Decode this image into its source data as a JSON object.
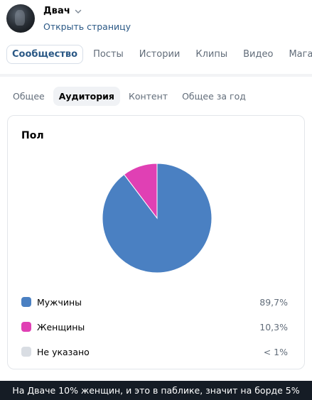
{
  "header": {
    "page_name": "Двач",
    "open_link": "Открыть страницу",
    "tabs": [
      {
        "label": "Сообщество",
        "active": true
      },
      {
        "label": "Посты",
        "active": false
      },
      {
        "label": "Истории",
        "active": false
      },
      {
        "label": "Клипы",
        "active": false
      },
      {
        "label": "Видео",
        "active": false
      },
      {
        "label": "Магаз",
        "active": false
      }
    ]
  },
  "stats": {
    "sub_tabs": [
      {
        "label": "Общее",
        "active": false
      },
      {
        "label": "Аудитория",
        "active": true
      },
      {
        "label": "Контент",
        "active": false
      },
      {
        "label": "Общее за год",
        "active": false
      }
    ],
    "card_title": "Пол"
  },
  "chart_data": {
    "type": "pie",
    "title": "Пол",
    "categories": [
      "Мужчины",
      "Женщины",
      "Не указано"
    ],
    "values": [
      89.7,
      10.3,
      0
    ],
    "value_labels": [
      "89,7%",
      "10,3%",
      "< 1%"
    ],
    "colors": [
      "#4a80c2",
      "#e040b4",
      "#d9dde3"
    ]
  },
  "caption": "На Дваче 10% женщин, и это в паблике, значит на борде 5%",
  "colors": {
    "accent": "#2a5885",
    "caption_bg": "#151c25"
  }
}
